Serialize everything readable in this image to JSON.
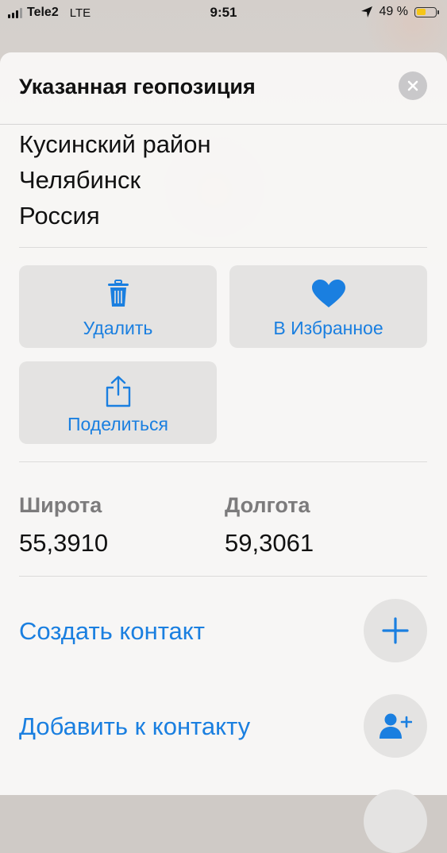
{
  "status_bar": {
    "carrier": "Tele2",
    "network": "LTE",
    "time": "9:51",
    "battery_percent": "49 %",
    "battery_level": 0.49
  },
  "sheet": {
    "title": "Указанная геопозиция",
    "address": [
      "Кусинский район",
      "Челябинск",
      "Россия"
    ]
  },
  "actions": {
    "delete_label": "Удалить",
    "favorite_label": "В Избранное",
    "share_label": "Поделиться"
  },
  "coordinates": {
    "lat_label": "Широта",
    "lat_value": "55,3910",
    "lon_label": "Долгота",
    "lon_value": "59,3061"
  },
  "contacts": {
    "create_label": "Создать контакт",
    "add_label": "Добавить к контакту"
  },
  "colors": {
    "accent": "#1a7fe0",
    "battery": "#f5c518"
  },
  "icons": [
    "close-icon",
    "trash-icon",
    "heart-icon",
    "share-icon",
    "plus-icon",
    "add-person-icon",
    "location-arrow-icon"
  ]
}
